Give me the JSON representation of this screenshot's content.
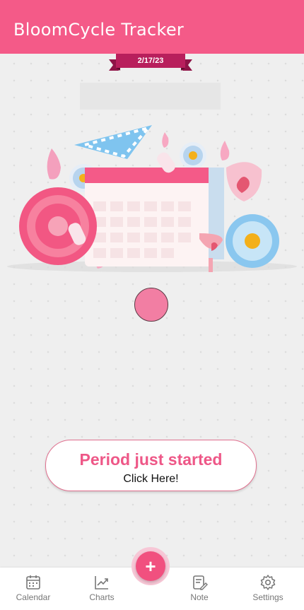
{
  "app": {
    "title": "BloomCycle Tracker",
    "accent": "#f45a88"
  },
  "date_ribbon": {
    "text": "2/17/23",
    "color": "#b81f5c"
  },
  "illustration": {
    "description_icon": "calendar-flowers-illustration"
  },
  "indicator": {
    "color": "#f27ea3"
  },
  "period_button": {
    "title": "Period just started",
    "subtitle": "Click Here!"
  },
  "fab": {
    "label": "+"
  },
  "nav": {
    "items": [
      {
        "label": "Calendar",
        "icon": "calendar-icon"
      },
      {
        "label": "Charts",
        "icon": "chart-icon"
      },
      {
        "label": "Note",
        "icon": "note-icon"
      },
      {
        "label": "Settings",
        "icon": "gear-icon"
      }
    ]
  }
}
